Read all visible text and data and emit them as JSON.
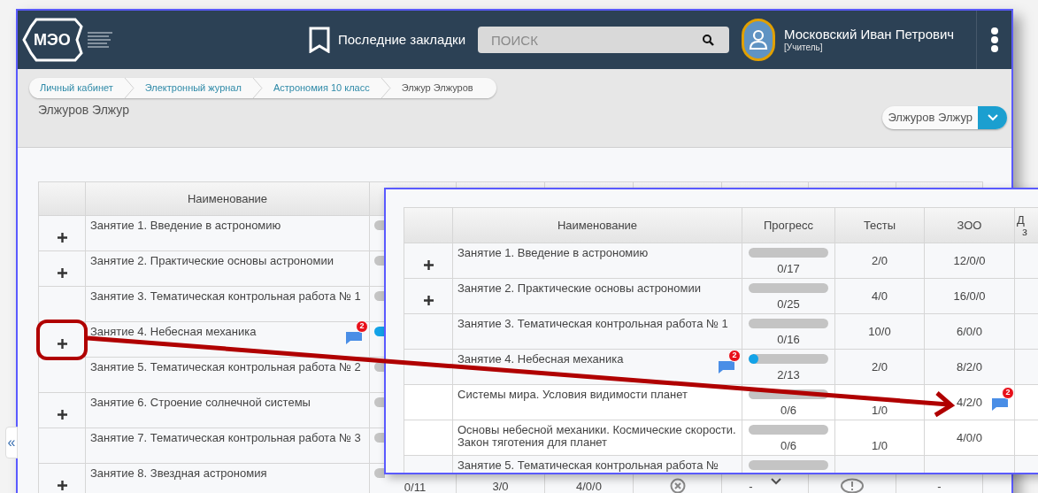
{
  "header": {
    "logo": "МЭО",
    "bookmarks": "Последние закладки",
    "search": {
      "placeholder": "ПОИСК"
    },
    "user": {
      "name": "Московский Иван Петрович",
      "role": "[Учитель]"
    }
  },
  "breadcrumbs": [
    {
      "label": "Личный кабинет",
      "current": false
    },
    {
      "label": "Электронный журнал",
      "current": false
    },
    {
      "label": "Астрономия 10 класс",
      "current": false
    },
    {
      "label": "Элжур Элжуров",
      "current": true
    }
  ],
  "page_title": "Элжуров Элжур",
  "student_select": {
    "value": "Элжуров Элжур"
  },
  "collapse_handle": "«",
  "journal": {
    "name_column": "Наименование",
    "rows": [
      {
        "name": "Занятие 1. Введение в астрономию",
        "expandable": true,
        "started": false
      },
      {
        "name": "Занятие 2. Практические основы астрономии",
        "expandable": true,
        "started": false
      },
      {
        "name": "Занятие 3. Тематическая контрольная работа № 1",
        "expandable": false,
        "started": false
      },
      {
        "name": "Занятие 4. Небесная механика",
        "expandable": true,
        "comments": "2",
        "started": true
      },
      {
        "name": "Занятие 5. Тематическая контрольная работа № 2",
        "expandable": false,
        "started": false
      },
      {
        "name": "Занятие 6. Строение солнечной системы",
        "expandable": true,
        "started": false
      },
      {
        "name": "Занятие 7. Тематическая контрольная работа № 3",
        "expandable": false,
        "started": false
      },
      {
        "name": "Занятие 8. Звездная астрономия",
        "expandable": true,
        "started": false,
        "progress": "0/11",
        "tests": "3/0",
        "zoo": "4/0/0",
        "column_6": "-",
        "column_8": "-"
      }
    ]
  },
  "zoomed_inset": {
    "columns": [
      "",
      "Наименование",
      "Прогресс",
      "Тесты",
      "ЗОО"
    ],
    "column_6": [
      "Д",
      "з"
    ],
    "rows": [
      {
        "kind": "lesson",
        "name": "Занятие 1. Введение в астрономию",
        "expandable": true,
        "level": 0,
        "progress": "0/17",
        "tests": "2/0",
        "zoo": "12/0/0"
      },
      {
        "kind": "lesson",
        "name": "Занятие 2. Практические основы астрономии",
        "expandable": true,
        "level": 0,
        "progress": "0/25",
        "tests": "4/0",
        "zoo": "16/0/0"
      },
      {
        "kind": "lesson",
        "name": "Занятие 3. Тематическая контрольная работа № 1",
        "expandable": false,
        "level": 0,
        "progress": "0/16",
        "tests": "10/0",
        "zoo": "6/0/0"
      },
      {
        "kind": "lesson",
        "name": "Занятие 4. Небесная механика",
        "expandable": false,
        "comments": "2",
        "level": 0.12,
        "progress": "2/13",
        "tests": "2/0",
        "zoo": "8/2/0"
      },
      {
        "kind": "topic",
        "name": "Системы мира. Условия видимости планет",
        "level": 0,
        "progress": "0/6",
        "tests": "1/0",
        "zoo": "4/2/0",
        "zoo_comments": "2"
      },
      {
        "kind": "topic",
        "name": "Основы небесной механики. Космические скорости. Закон тяготения для планет",
        "level": 0,
        "progress": "0/6",
        "tests": "1/0",
        "zoo": "4/0/0"
      },
      {
        "kind": "lesson",
        "name": "Занятие 5. Тематическая контрольная работа №",
        "level": 0
      }
    ]
  }
}
